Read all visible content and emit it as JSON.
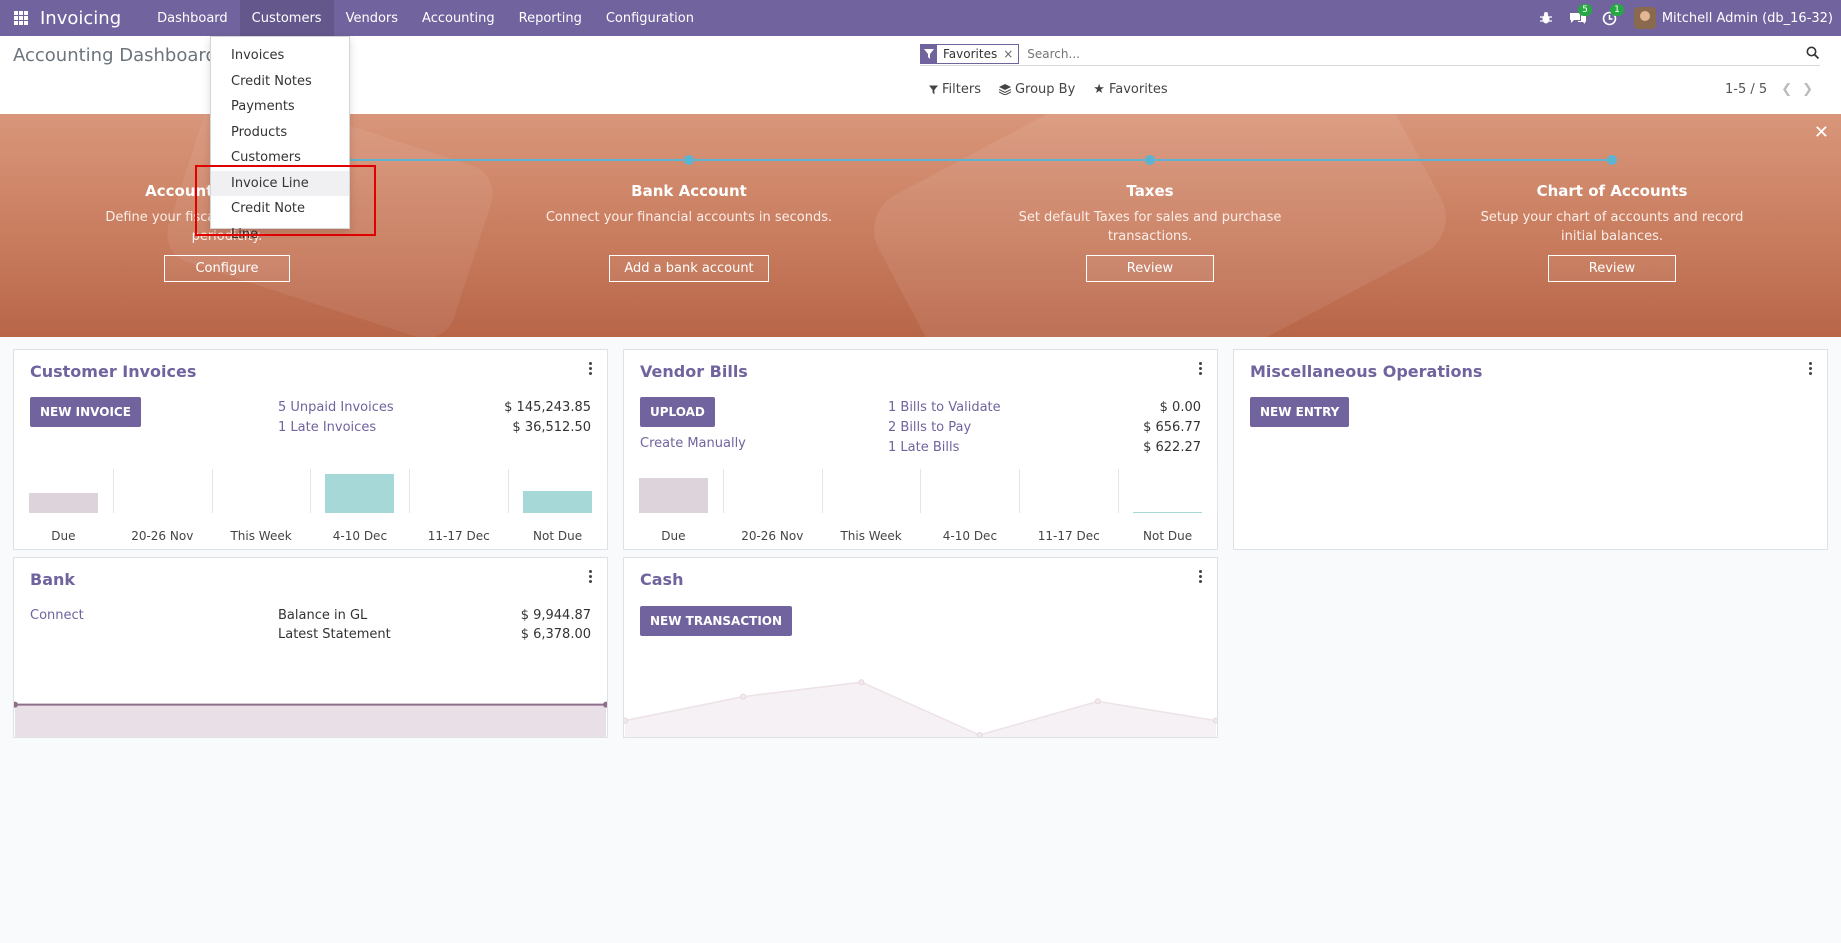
{
  "navbar": {
    "brand": "Invoicing",
    "menu": [
      {
        "label": "Dashboard",
        "active": false
      },
      {
        "label": "Customers",
        "active": true
      },
      {
        "label": "Vendors",
        "active": false
      },
      {
        "label": "Accounting",
        "active": false
      },
      {
        "label": "Reporting",
        "active": false
      },
      {
        "label": "Configuration",
        "active": false
      }
    ],
    "messages_count": "5",
    "activities_count": "1",
    "user": "Mitchell Admin (db_16-32)"
  },
  "control": {
    "title": "Accounting Dashboard",
    "facet_label": "Favorites",
    "search_placeholder": "Search...",
    "filters_label": "Filters",
    "groupby_label": "Group By",
    "favorites_label": "Favorites",
    "pager": "1-5 / 5"
  },
  "dropdown": {
    "items": [
      "Invoices",
      "Credit Notes",
      "Payments",
      "Products",
      "Customers",
      "Invoice Line",
      "Credit Note Line"
    ]
  },
  "banner": {
    "steps": [
      {
        "title": "Accounting Periods",
        "desc": "Define your fiscal years & tax returns periodicity.",
        "button": "Configure"
      },
      {
        "title": "Bank Account",
        "desc": "Connect your financial accounts in seconds.",
        "button": "Add a bank account"
      },
      {
        "title": "Taxes",
        "desc": "Set default Taxes for sales and purchase transactions.",
        "button": "Review"
      },
      {
        "title": "Chart of Accounts",
        "desc": "Setup your chart of accounts and record initial balances.",
        "button": "Review"
      }
    ]
  },
  "cards": {
    "customer_invoices": {
      "title": "Customer Invoices",
      "button": "NEW INVOICE",
      "stats": [
        {
          "label": "5 Unpaid Invoices",
          "amount": "$ 145,243.85"
        },
        {
          "label": "1 Late Invoices",
          "amount": "$ 36,512.50"
        }
      ]
    },
    "vendor_bills": {
      "title": "Vendor Bills",
      "button": "UPLOAD",
      "secondary": "Create Manually",
      "stats": [
        {
          "label": "1 Bills to Validate",
          "amount": "$ 0.00"
        },
        {
          "label": "2 Bills to Pay",
          "amount": "$ 656.77"
        },
        {
          "label": "1 Late Bills",
          "amount": "$ 622.27"
        }
      ]
    },
    "misc": {
      "title": "Miscellaneous Operations",
      "button": "NEW ENTRY"
    },
    "bank": {
      "title": "Bank",
      "link": "Connect",
      "stats": [
        {
          "label": "Balance in GL",
          "amount": "$ 9,944.87"
        },
        {
          "label": "Latest Statement",
          "amount": "$ 6,378.00"
        }
      ]
    },
    "cash": {
      "title": "Cash",
      "button": "NEW TRANSACTION"
    }
  },
  "chart_data": [
    {
      "type": "bar",
      "categories": [
        "Due",
        "20-26 Nov",
        "This Week",
        "4-10 Dec",
        "11-17 Dec",
        "Not Due"
      ],
      "values": [
        20,
        0,
        0,
        40,
        0,
        22
      ],
      "colors": [
        "#ddd3db",
        "#ddd3db",
        "#a5d8d7",
        "#a5d8d7",
        "#a5d8d7",
        "#a5d8d7"
      ]
    },
    {
      "type": "bar",
      "categories": [
        "Due",
        "20-26 Nov",
        "This Week",
        "4-10 Dec",
        "11-17 Dec",
        "Not Due"
      ],
      "values": [
        36,
        0,
        0,
        0,
        0,
        1
      ],
      "colors": [
        "#ddd3db",
        "#ddd3db",
        "#a5d8d7",
        "#a5d8d7",
        "#a5d8d7",
        "#a5d8d7"
      ]
    },
    {
      "type": "area",
      "values": [
        40,
        40
      ]
    },
    {
      "type": "line",
      "values": [
        3,
        8,
        11,
        0,
        7,
        3
      ]
    }
  ]
}
